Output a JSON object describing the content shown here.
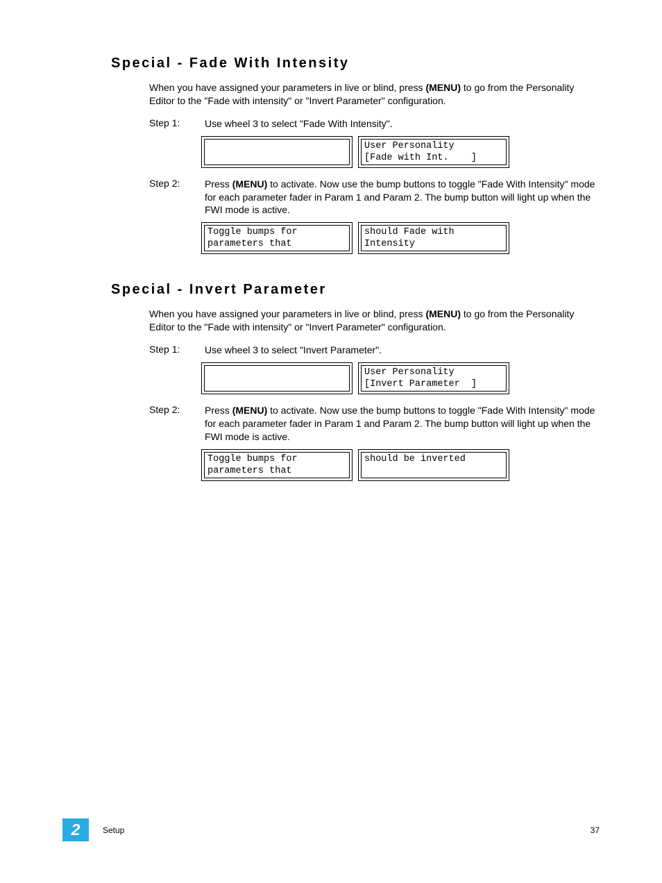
{
  "sectionA": {
    "title": "Special - Fade With Intensity",
    "intro_before": "When you have assigned your parameters in live or blind, press ",
    "intro_bold": "(MENU)",
    "intro_after": " to go from the Personality Editor to the \"Fade with intensity\" or \"Invert Parameter\" configuration.",
    "step1_label": "Step 1:",
    "step1_body": "Use wheel 3 to select \"Fade With Intensity\".",
    "lcd1_left": "",
    "lcd1_right": "User Personality\n[Fade with Int.    ]",
    "step2_label": "Step 2:",
    "step2_before": "Press ",
    "step2_bold": "(MENU)",
    "step2_after": " to activate. Now use the bump buttons to toggle \"Fade With Intensity\" mode for each parameter fader in Param 1 and Param 2. The bump button will light up when the FWI mode is active.",
    "lcd2_left": "Toggle bumps for\nparameters that",
    "lcd2_right": "should Fade with\nIntensity"
  },
  "sectionB": {
    "title": "Special - Invert Parameter",
    "intro_before": "When you have assigned your parameters in live or blind, press ",
    "intro_bold": "(MENU)",
    "intro_after": " to go from the Personality Editor to the \"Fade with intensity\" or \"Invert Parameter\" configuration.",
    "step1_label": "Step 1:",
    "step1_body": "Use wheel 3 to select \"Invert Parameter\".",
    "lcd1_left": "",
    "lcd1_right": "User Personality\n[Invert Parameter  ]",
    "step2_label": "Step 2:",
    "step2_before": "Press ",
    "step2_bold": "(MENU)",
    "step2_after": " to activate. Now use the bump buttons to toggle \"Fade With Intensity\" mode for each parameter fader in Param 1 and Param 2. The bump button will light up when the FWI mode is active.",
    "lcd2_left": "Toggle bumps for\nparameters that",
    "lcd2_right": "should be inverted"
  },
  "footer": {
    "chapter": "2",
    "section": "Setup",
    "page": "37"
  }
}
